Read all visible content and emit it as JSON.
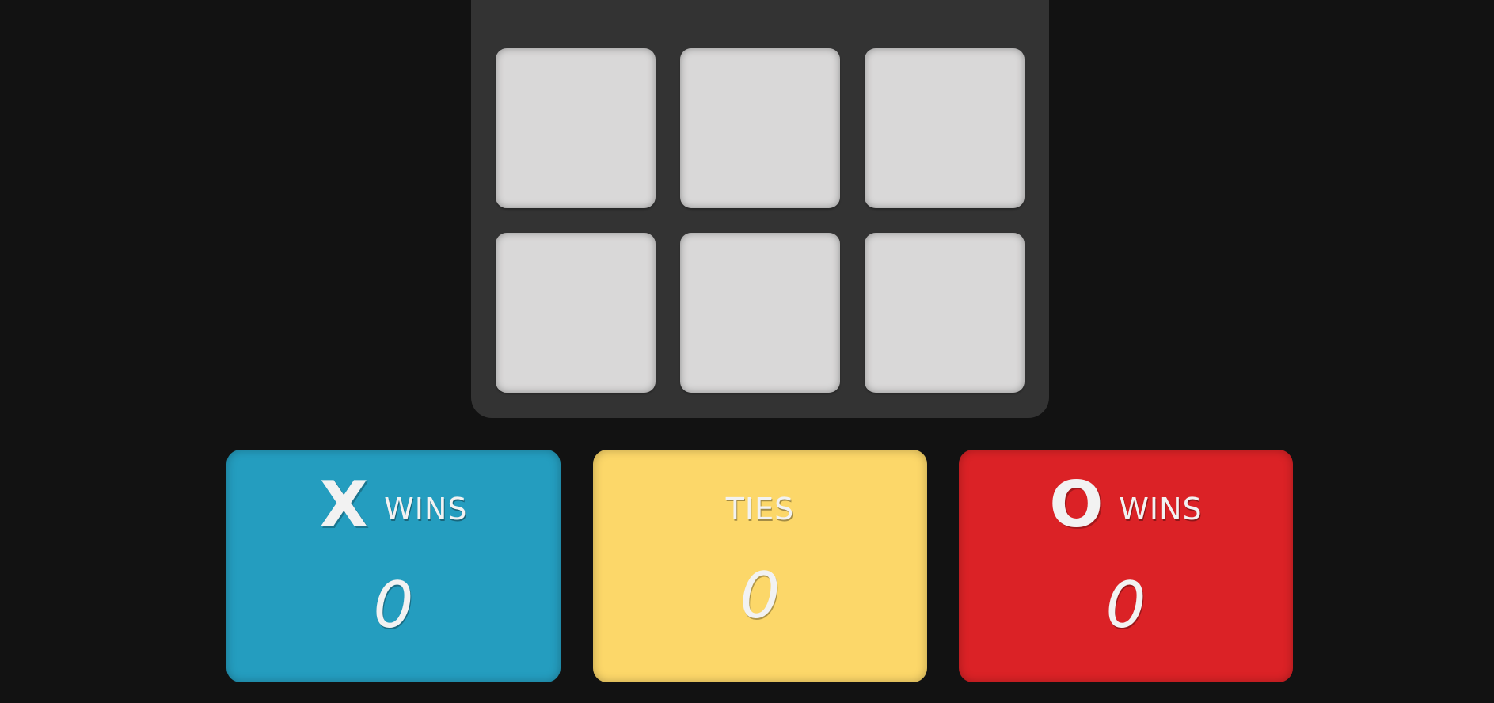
{
  "board": {
    "cells": [
      "",
      "",
      "",
      "",
      "",
      "",
      "",
      "",
      "",
      "",
      "",
      ""
    ]
  },
  "scores": {
    "x": {
      "mark": "X",
      "label": "WINS",
      "value": "0",
      "color": "#249dbf"
    },
    "ties": {
      "label": "TIES",
      "value": "0",
      "color": "#fcd769"
    },
    "o": {
      "mark": "O",
      "label": "WINS",
      "value": "0",
      "color": "#db2226"
    }
  }
}
